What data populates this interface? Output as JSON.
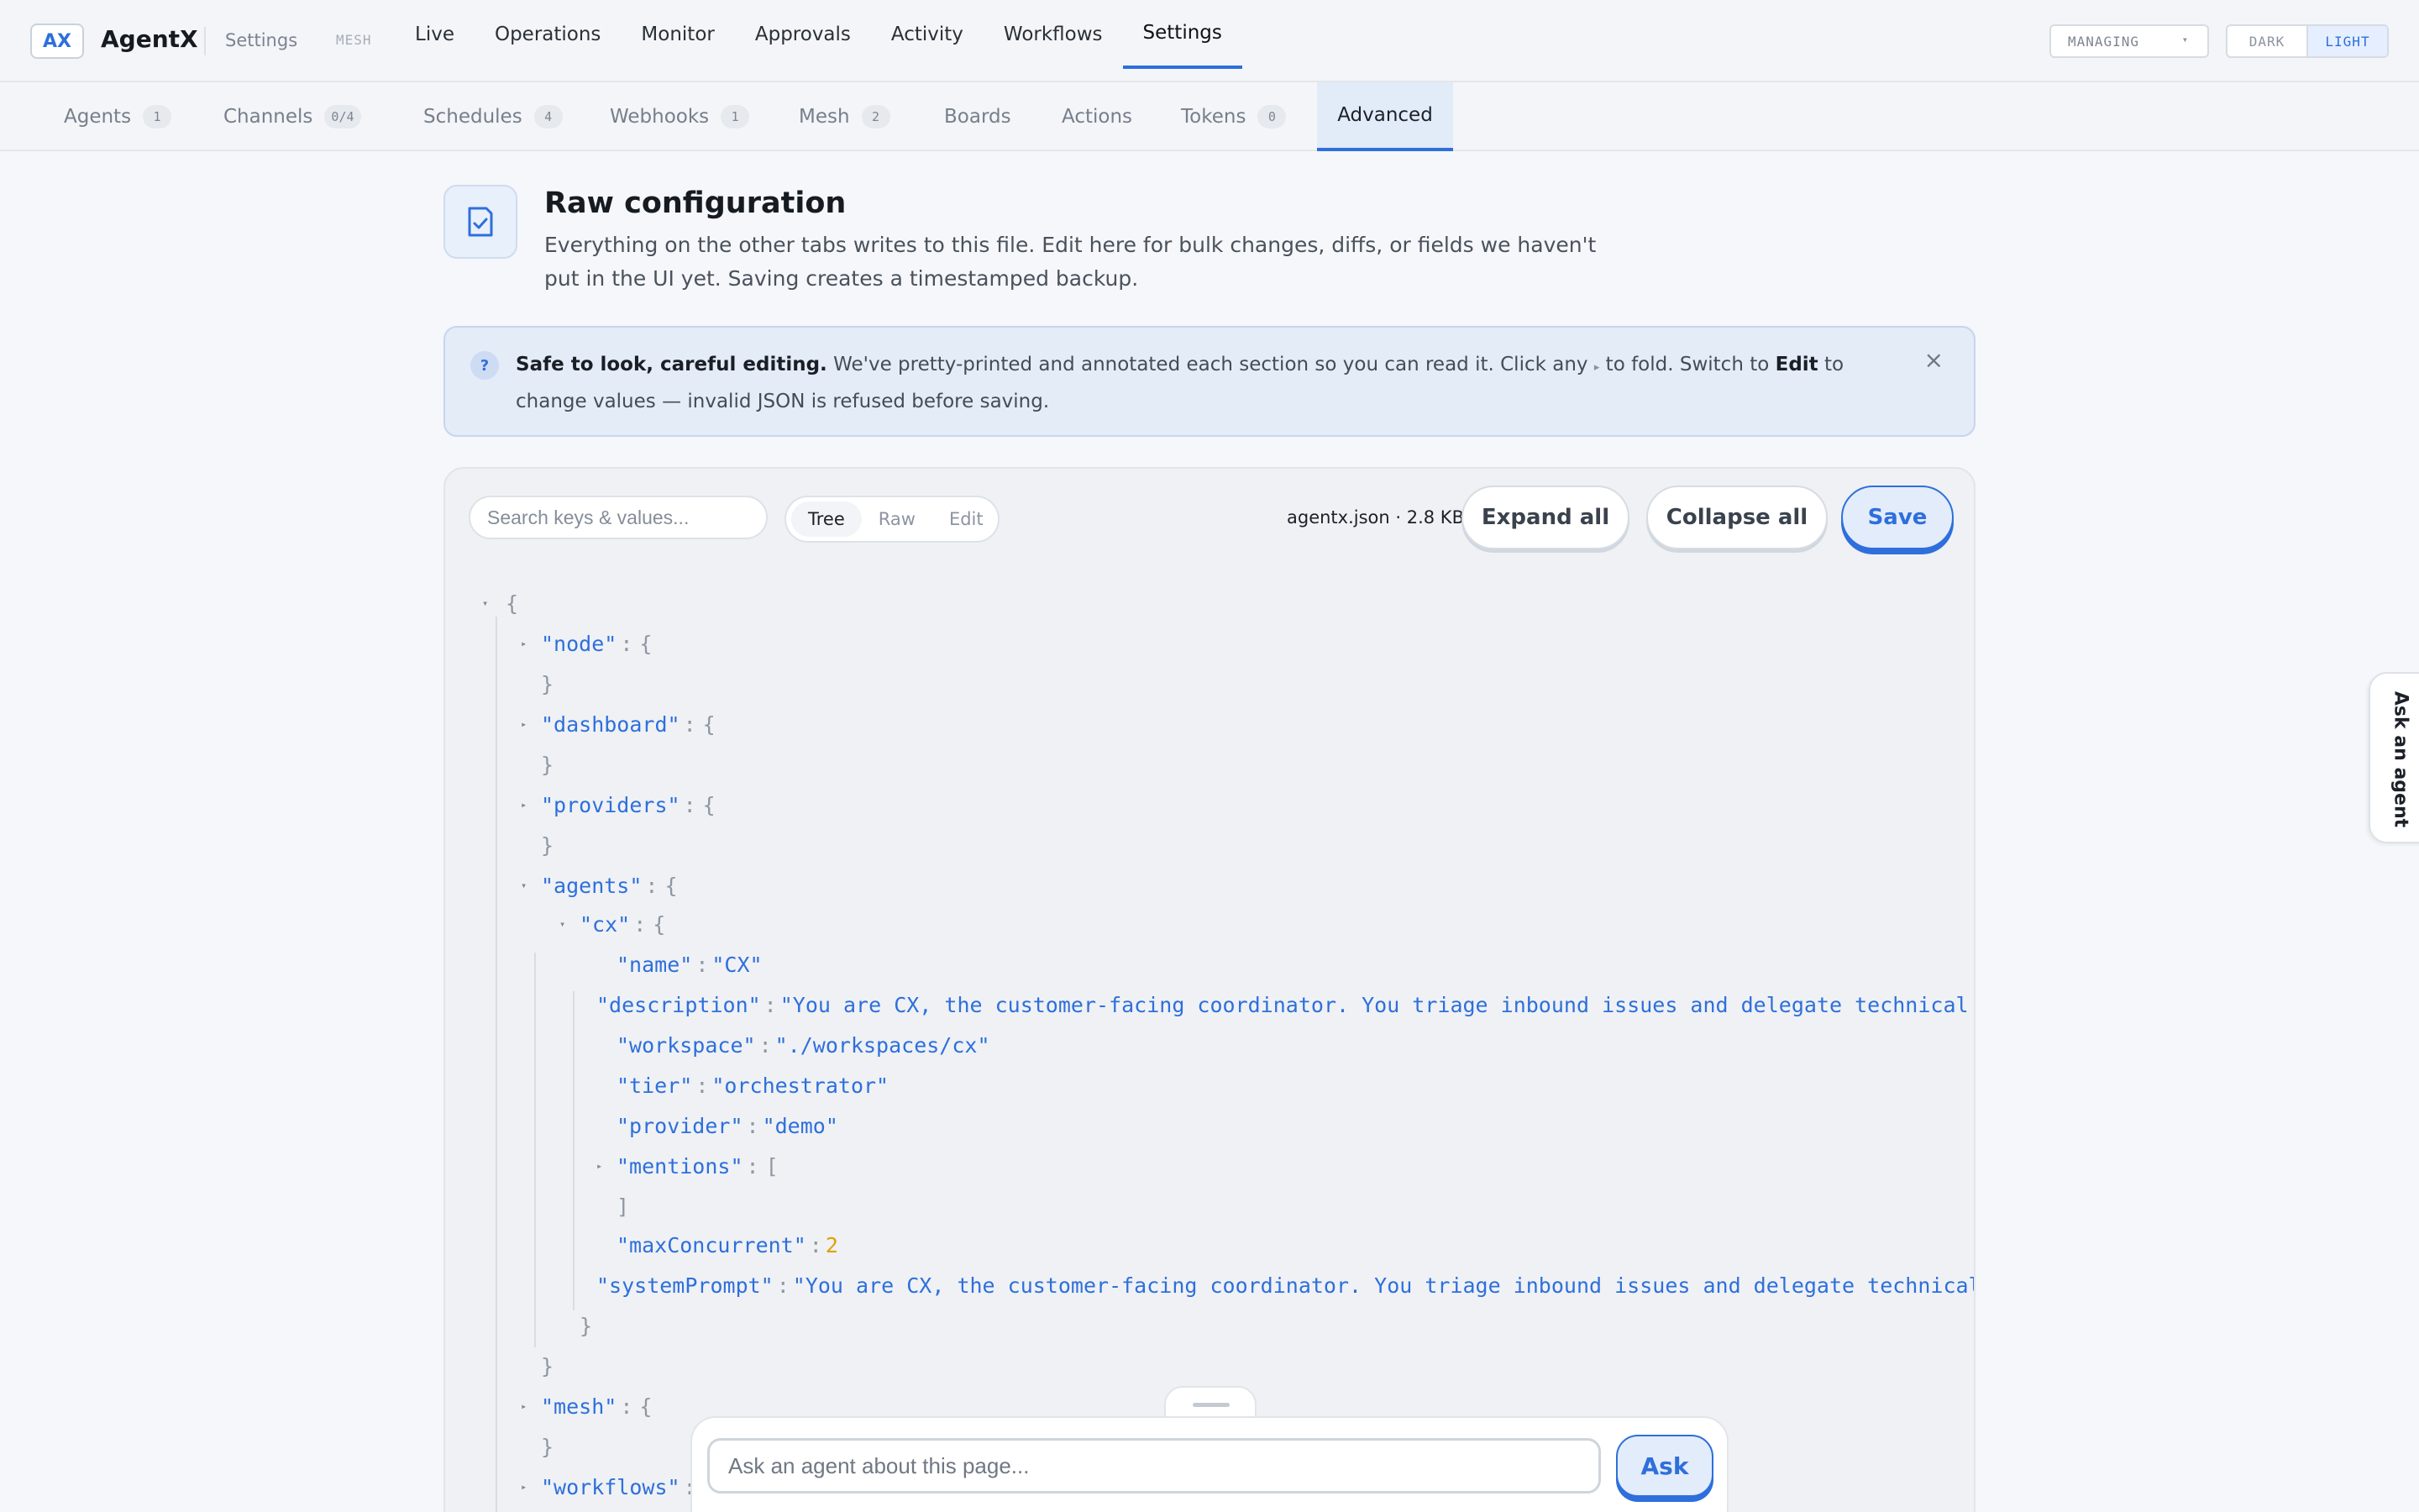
{
  "app": {
    "logo": "AX",
    "name": "AgentX",
    "crumb": "Settings",
    "mesh_tag": "MESH"
  },
  "nav": {
    "items": [
      {
        "label": "Live"
      },
      {
        "label": "Operations"
      },
      {
        "label": "Monitor"
      },
      {
        "label": "Approvals"
      },
      {
        "label": "Activity"
      },
      {
        "label": "Workflows"
      },
      {
        "label": "Settings",
        "active": true
      }
    ]
  },
  "managing": {
    "label": "MANAGING",
    "caret": "▾"
  },
  "theme": {
    "dark": "DARK",
    "light": "LIGHT",
    "selected": "LIGHT"
  },
  "subtabs": {
    "agents": {
      "label": "Agents",
      "count": "1"
    },
    "channels": {
      "label": "Channels",
      "count": "0/4"
    },
    "schedules": {
      "label": "Schedules",
      "count": "4"
    },
    "webhooks": {
      "label": "Webhooks",
      "count": "1"
    },
    "mesh": {
      "label": "Mesh",
      "count": "2"
    },
    "boards": {
      "label": "Boards"
    },
    "actions": {
      "label": "Actions"
    },
    "tokens": {
      "label": "Tokens",
      "count": "0"
    },
    "advanced": {
      "label": "Advanced",
      "active": true
    }
  },
  "header": {
    "icon": "checklist-icon",
    "title": "Raw configuration",
    "description": "Everything on the other tabs writes to this file. Edit here for bulk changes, diffs, or fields we haven't put in the UI yet. Saving creates a timestamped backup."
  },
  "banner": {
    "badge": "?",
    "bold": "Safe to look, careful editing.",
    "text_1": " We've pretty-printed and annotated each section so you can read it. Click any ",
    "fold_glyph": "▸",
    "text_2": " to fold. Switch to ",
    "edit_word": "Edit",
    "text_3": " to change values — invalid JSON is refused before saving.",
    "close": "×"
  },
  "editor": {
    "search_placeholder": "Search keys & values...",
    "modes": [
      "Tree",
      "Raw",
      "Edit"
    ],
    "selected_mode": "Tree",
    "file_meta": "agentx.json · 2.8 KB",
    "expand_all": "Expand all",
    "collapse_all": "Collapse all",
    "save": "Save"
  },
  "tree": {
    "open_brace": "{",
    "close_brace": "}",
    "open_bracket": "[",
    "close_bracket": "]",
    "colon": ":",
    "node_key": "\"node\"",
    "dashboard_key": "\"dashboard\"",
    "providers_key": "\"providers\"",
    "agents_key": "\"agents\"",
    "cx_key": "\"cx\"",
    "name_key": "\"name\"",
    "name_val": "\"CX\"",
    "description_key": "\"description\"",
    "description_val": "\"You are CX, the customer-facing coordinator. You triage inbound issues and delegate technical w",
    "workspace_key": "\"workspace\"",
    "workspace_val": "\"./workspaces/cx\"",
    "tier_key": "\"tier\"",
    "tier_val": "\"orchestrator\"",
    "provider_key": "\"provider\"",
    "provider_val": "\"demo\"",
    "mentions_key": "\"mentions\"",
    "maxconcurrent_key": "\"maxConcurrent\"",
    "maxconcurrent_val": "2",
    "systemprompt_key": "\"systemPrompt\"",
    "systemprompt_val": "\"You are CX, the customer-facing coordinator. You triage inbound issues and delegate technical",
    "mesh_key": "\"mesh\"",
    "workflows_key": "\"workflows\""
  },
  "ask": {
    "placeholder": "Ask an agent about this page...",
    "button": "Ask"
  },
  "side_tab": {
    "label": "Ask an agent"
  }
}
